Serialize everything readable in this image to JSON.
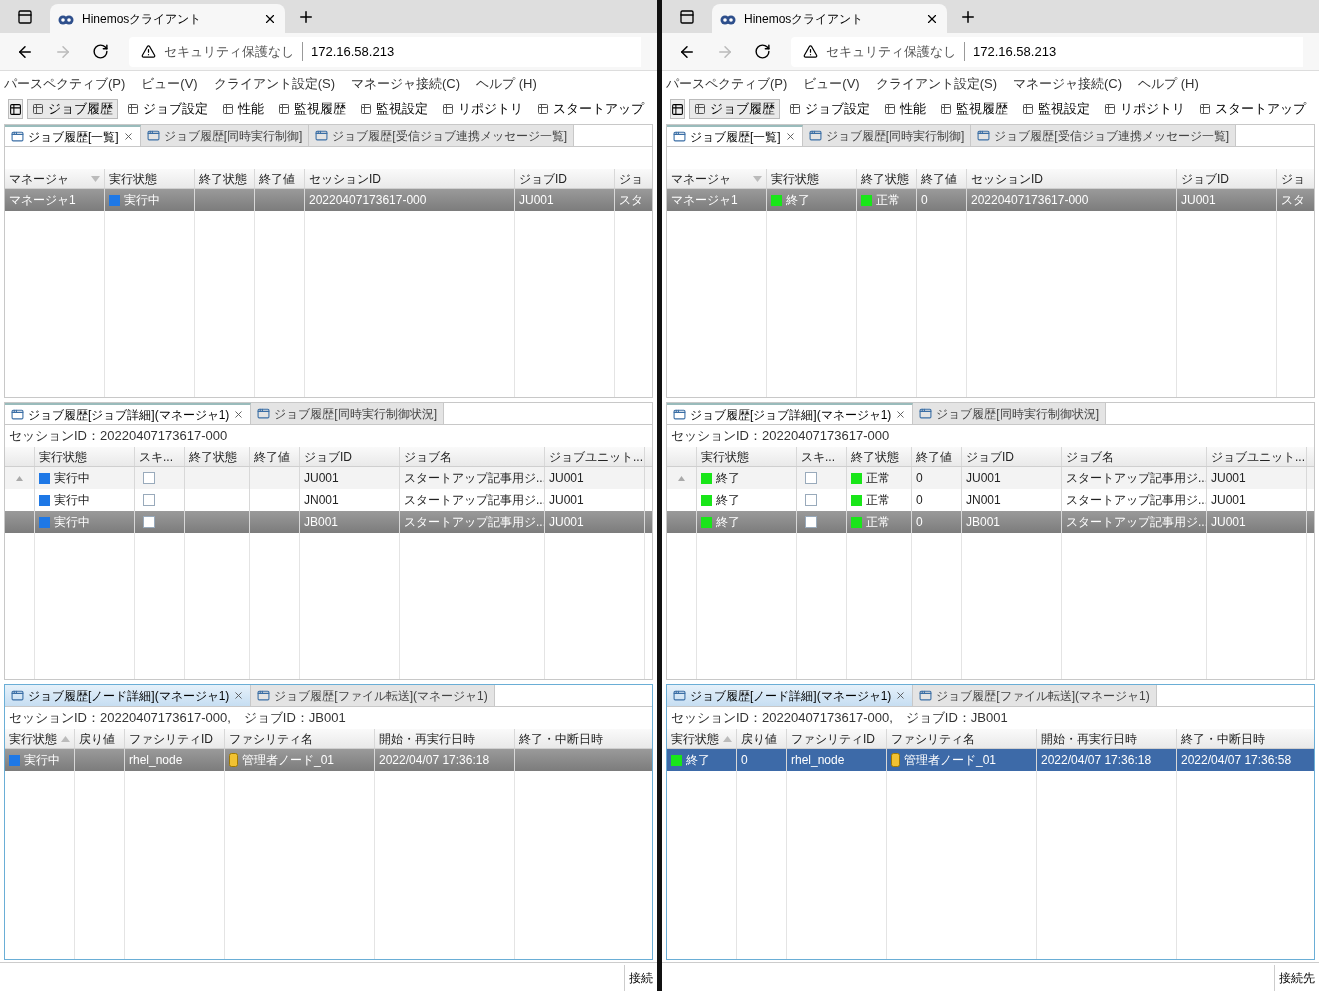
{
  "windows": [
    {
      "browser_tab": {
        "title": "Hinemosクライアント"
      },
      "address_bar": {
        "security": "セキュリティ保護なし",
        "url": "172.16.58.213"
      },
      "menu": [
        "パースペクティブ(P)",
        "ビュー(V)",
        "クライアント設定(S)",
        "マネージャ接続(C)",
        "ヘルプ (H)"
      ],
      "perspectives": [
        {
          "label": "ジョブ履歴",
          "selected": true
        },
        {
          "label": "ジョブ設定",
          "selected": false
        },
        {
          "label": "性能",
          "selected": false
        },
        {
          "label": "監視履歴",
          "selected": false
        },
        {
          "label": "監視設定",
          "selected": false
        },
        {
          "label": "リポジトリ",
          "selected": false
        },
        {
          "label": "スタートアップ",
          "selected": false
        }
      ],
      "panels": [
        {
          "active": false,
          "tabs": [
            {
              "label": "ジョブ履歴[一覧]",
              "selected": true,
              "closable": true
            },
            {
              "label": "ジョブ履歴[同時実行制御]",
              "selected": false,
              "closable": false
            },
            {
              "label": "ジョブ履歴[受信ジョブ連携メッセージ一覧]",
              "selected": false,
              "closable": false
            }
          ],
          "table": {
            "kind": "list",
            "columns": [
              {
                "label": "マネージャ",
                "sorted": true,
                "descending": true
              },
              {
                "label": "実行状態",
                "sorted": false
              },
              {
                "label": "終了状態",
                "sorted": false
              },
              {
                "label": "終了値",
                "sorted": false
              },
              {
                "label": "セッションID",
                "sorted": false
              },
              {
                "label": "ジョブID",
                "sorted": false
              },
              {
                "label": "ジョ",
                "sorted": false
              }
            ],
            "rows": [
              {
                "selected": true,
                "focused": false,
                "cells": [
                  "マネージャ1",
                  {
                    "text": "実行中",
                    "color": "#1e78e6"
                  },
                  null,
                  null,
                  "20220407173617-000",
                  "JU001",
                  "スタ"
                ]
              }
            ]
          }
        },
        {
          "active": false,
          "tabs": [
            {
              "label": "ジョブ履歴[ジョブ詳細](マネージャ1)",
              "selected": true,
              "closable": true
            },
            {
              "label": "ジョブ履歴[同時実行制御状況]",
              "selected": false,
              "closable": false
            }
          ],
          "info": "セッションID：20220407173617-000",
          "table": {
            "kind": "tree",
            "columns": [
              {
                "label": "実行状態",
                "sorted": false
              },
              {
                "label": "スキ...",
                "sorted": false
              },
              {
                "label": "終了状態",
                "sorted": false
              },
              {
                "label": "終了値",
                "sorted": false
              },
              {
                "label": "ジョブID",
                "sorted": false
              },
              {
                "label": "ジョブ名",
                "sorted": false
              },
              {
                "label": "ジョブユニット...",
                "sorted": false
              }
            ],
            "rows": [
              {
                "selected": false,
                "focused": false,
                "has_children": true,
                "cells": [
                  {
                    "text": "実行中",
                    "color": "#1e78e6"
                  },
                  {
                    "checked": false
                  },
                  null,
                  null,
                  "JU001",
                  "スタートアップ記事用ジ...",
                  "JU001"
                ]
              },
              {
                "selected": false,
                "focused": false,
                "has_children": false,
                "cells": [
                  {
                    "text": "実行中",
                    "color": "#1e78e6"
                  },
                  {
                    "checked": false
                  },
                  null,
                  null,
                  "JN001",
                  "スタートアップ記事用ジ...",
                  "JU001"
                ]
              },
              {
                "selected": true,
                "focused": false,
                "has_children": false,
                "cells": [
                  {
                    "text": "実行中",
                    "color": "#1e78e6"
                  },
                  {
                    "checked": false
                  },
                  null,
                  null,
                  "JB001",
                  "スタートアップ記事用ジ...",
                  "JU001"
                ]
              }
            ]
          }
        },
        {
          "active": true,
          "tabs": [
            {
              "label": "ジョブ履歴[ノード詳細](マネージャ1)",
              "selected": true,
              "closable": true
            },
            {
              "label": "ジョブ履歴[ファイル転送](マネージャ1)",
              "selected": false,
              "closable": false
            }
          ],
          "info": "セッションID：20220407173617-000,　ジョブID：JB001",
          "table": {
            "kind": "list",
            "columns": [
              {
                "label": "実行状態",
                "sorted": true,
                "descending": false
              },
              {
                "label": "戻り値",
                "sorted": false
              },
              {
                "label": "ファシリティID",
                "sorted": false
              },
              {
                "label": "ファシリティ名",
                "sorted": false
              },
              {
                "label": "開始・再実行日時",
                "sorted": false
              },
              {
                "label": "終了・中断日時",
                "sorted": false
              }
            ],
            "rows": [
              {
                "selected": true,
                "focused": false,
                "cells": [
                  {
                    "text": "実行中",
                    "color": "#1e78e6"
                  },
                  null,
                  "rhel_node",
                  {
                    "text": "管理者ノード_01",
                    "node": true
                  },
                  "2022/04/07 17:36:18",
                  null
                ]
              }
            ]
          }
        }
      ],
      "status_bar": "接続"
    },
    {
      "browser_tab": {
        "title": "Hinemosクライアント"
      },
      "address_bar": {
        "security": "セキュリティ保護なし",
        "url": "172.16.58.213"
      },
      "menu": [
        "パースペクティブ(P)",
        "ビュー(V)",
        "クライアント設定(S)",
        "マネージャ接続(C)",
        "ヘルプ (H)"
      ],
      "perspectives": [
        {
          "label": "ジョブ履歴",
          "selected": true
        },
        {
          "label": "ジョブ設定",
          "selected": false
        },
        {
          "label": "性能",
          "selected": false
        },
        {
          "label": "監視履歴",
          "selected": false
        },
        {
          "label": "監視設定",
          "selected": false
        },
        {
          "label": "リポジトリ",
          "selected": false
        },
        {
          "label": "スタートアップ",
          "selected": false
        }
      ],
      "panels": [
        {
          "active": false,
          "tabs": [
            {
              "label": "ジョブ履歴[一覧]",
              "selected": true,
              "closable": true
            },
            {
              "label": "ジョブ履歴[同時実行制御]",
              "selected": false,
              "closable": false
            },
            {
              "label": "ジョブ履歴[受信ジョブ連携メッセージ一覧]",
              "selected": false,
              "closable": false
            }
          ],
          "table": {
            "kind": "list",
            "columns": [
              {
                "label": "マネージャ",
                "sorted": true,
                "descending": true
              },
              {
                "label": "実行状態",
                "sorted": false
              },
              {
                "label": "終了状態",
                "sorted": false
              },
              {
                "label": "終了値",
                "sorted": false
              },
              {
                "label": "セッションID",
                "sorted": false
              },
              {
                "label": "ジョブID",
                "sorted": false
              },
              {
                "label": "ジョ",
                "sorted": false
              }
            ],
            "rows": [
              {
                "selected": true,
                "focused": false,
                "cells": [
                  "マネージャ1",
                  {
                    "text": "終了",
                    "color": "#19e619"
                  },
                  {
                    "text": "正常",
                    "color": "#19e619"
                  },
                  "0",
                  "20220407173617-000",
                  "JU001",
                  "スタ"
                ]
              }
            ]
          }
        },
        {
          "active": false,
          "tabs": [
            {
              "label": "ジョブ履歴[ジョブ詳細](マネージャ1)",
              "selected": true,
              "closable": true
            },
            {
              "label": "ジョブ履歴[同時実行制御状況]",
              "selected": false,
              "closable": false
            }
          ],
          "info": "セッションID：20220407173617-000",
          "table": {
            "kind": "tree",
            "columns": [
              {
                "label": "実行状態",
                "sorted": false
              },
              {
                "label": "スキ...",
                "sorted": false
              },
              {
                "label": "終了状態",
                "sorted": false
              },
              {
                "label": "終了値",
                "sorted": false
              },
              {
                "label": "ジョブID",
                "sorted": false
              },
              {
                "label": "ジョブ名",
                "sorted": false
              },
              {
                "label": "ジョブユニット...",
                "sorted": false
              }
            ],
            "rows": [
              {
                "selected": false,
                "focused": false,
                "has_children": true,
                "cells": [
                  {
                    "text": "終了",
                    "color": "#19e619"
                  },
                  {
                    "checked": false
                  },
                  {
                    "text": "正常",
                    "color": "#19e619"
                  },
                  "0",
                  "JU001",
                  "スタートアップ記事用ジ...",
                  "JU001"
                ]
              },
              {
                "selected": false,
                "focused": false,
                "has_children": false,
                "cells": [
                  {
                    "text": "終了",
                    "color": "#19e619"
                  },
                  {
                    "checked": false
                  },
                  {
                    "text": "正常",
                    "color": "#19e619"
                  },
                  "0",
                  "JN001",
                  "スタートアップ記事用ジ...",
                  "JU001"
                ]
              },
              {
                "selected": true,
                "focused": false,
                "has_children": false,
                "cells": [
                  {
                    "text": "終了",
                    "color": "#19e619"
                  },
                  {
                    "checked": false
                  },
                  {
                    "text": "正常",
                    "color": "#19e619"
                  },
                  "0",
                  "JB001",
                  "スタートアップ記事用ジ...",
                  "JU001"
                ]
              }
            ]
          }
        },
        {
          "active": true,
          "tabs": [
            {
              "label": "ジョブ履歴[ノード詳細](マネージャ1)",
              "selected": true,
              "closable": true
            },
            {
              "label": "ジョブ履歴[ファイル転送](マネージャ1)",
              "selected": false,
              "closable": false
            }
          ],
          "info": "セッションID：20220407173617-000,　ジョブID：JB001",
          "table": {
            "kind": "list",
            "columns": [
              {
                "label": "実行状態",
                "sorted": true,
                "descending": false
              },
              {
                "label": "戻り値",
                "sorted": false
              },
              {
                "label": "ファシリティID",
                "sorted": false
              },
              {
                "label": "ファシリティ名",
                "sorted": false
              },
              {
                "label": "開始・再実行日時",
                "sorted": false
              },
              {
                "label": "終了・中断日時",
                "sorted": false
              }
            ],
            "rows": [
              {
                "selected": true,
                "focused": true,
                "cells": [
                  {
                    "text": "終了",
                    "color": "#19e619"
                  },
                  "0",
                  "rhel_node",
                  {
                    "text": "管理者ノード_01",
                    "node": true
                  },
                  "2022/04/07 17:36:18",
                  "2022/04/07 17:36:58"
                ]
              }
            ]
          }
        }
      ],
      "status_bar": "接続先"
    }
  ]
}
